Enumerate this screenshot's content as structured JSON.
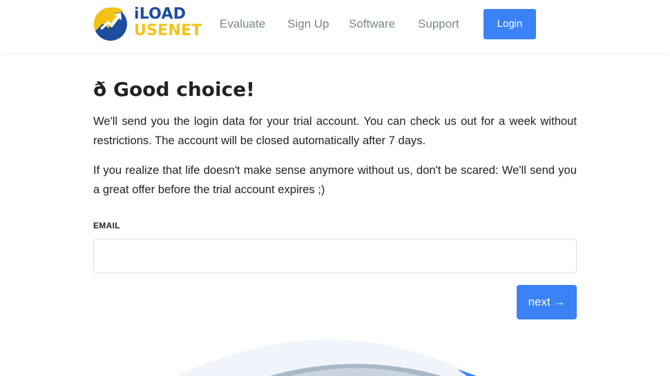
{
  "header": {
    "logo": {
      "line1": "iLOAD",
      "line2": "USENET",
      "colors": {
        "blue": "#1c4d9e",
        "yellow": "#f5c216"
      }
    },
    "nav": [
      {
        "label": "Evaluate"
      },
      {
        "label": "Sign Up"
      },
      {
        "label": "Software"
      },
      {
        "label": "Support"
      }
    ],
    "login_label": "Login"
  },
  "main": {
    "title": "ð Good choice!",
    "paragraph1": "We'll send you the login data for your trial account. You can check us out for a week without restrictions. The account will be closed automatically after 7 days.",
    "paragraph2": "If you realize that life doesn't make sense anymore without us, don't be scared: We'll send you a great offer before the trial account expires ;)"
  },
  "form": {
    "email_label": "EMAIL",
    "email_value": "",
    "next_label": "next",
    "next_icon": "arrow-right-icon"
  },
  "colors": {
    "accent": "#3b82f6",
    "nav_text": "#7a8390"
  }
}
